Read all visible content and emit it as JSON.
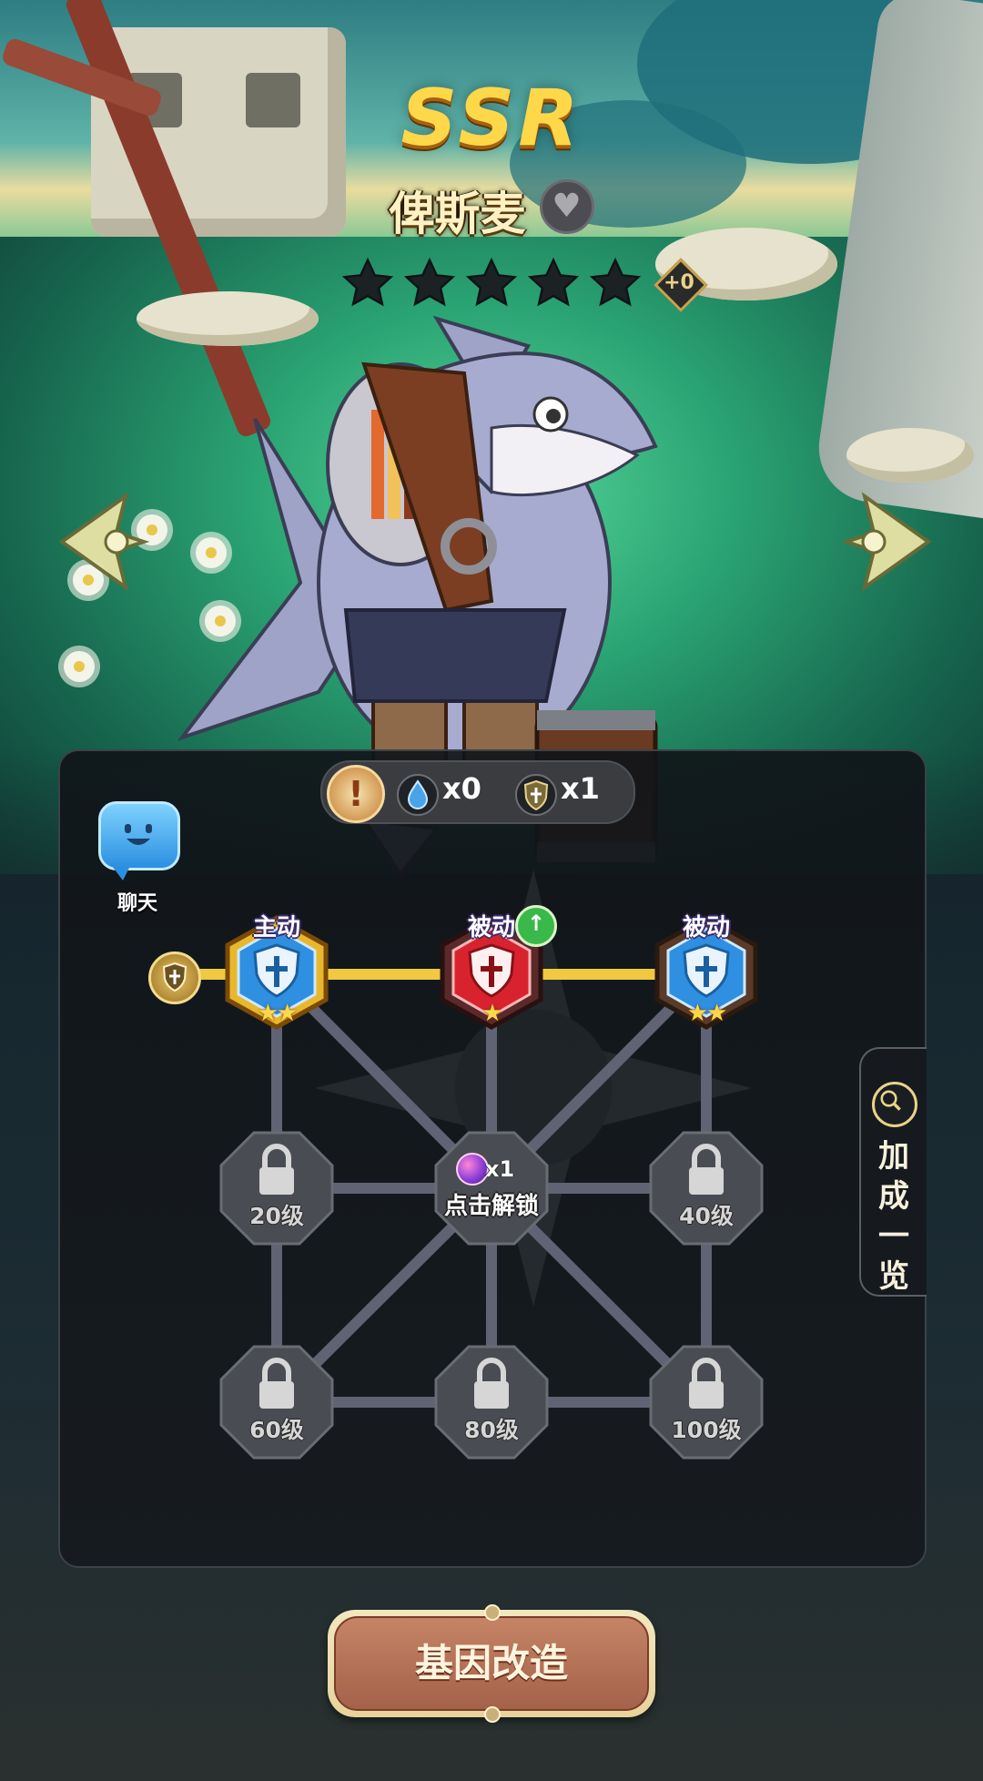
{
  "hero": {
    "rarity": "SSR",
    "name": "俾斯麦",
    "stars": 5,
    "star_bonus": "+0"
  },
  "resources": {
    "water_count": "x0",
    "shield_count": "x1"
  },
  "chat": {
    "label": "聊天"
  },
  "skills": [
    {
      "type": "主动",
      "stars": "★★",
      "color": "#2f8fe0"
    },
    {
      "type": "被动",
      "stars": "★",
      "color": "#d8232f",
      "upgrade": "↑"
    },
    {
      "type": "被动",
      "stars": "★★",
      "color": "#2f8fe0"
    }
  ],
  "gene_nodes": {
    "row1": [
      {
        "label": "20级",
        "locked": true
      },
      {
        "count": "x1",
        "label": "点击解锁",
        "locked": false
      },
      {
        "label": "40级",
        "locked": true
      }
    ],
    "row2": [
      {
        "label": "60级",
        "locked": true
      },
      {
        "label": "80级",
        "locked": true
      },
      {
        "label": "100级",
        "locked": true
      }
    ]
  },
  "bonus_tab": {
    "label": "加成一览"
  },
  "action": {
    "label": "基因改造"
  },
  "icons": {
    "favorite": "heart-icon",
    "warning": "exclamation-icon",
    "water": "water-drop-icon",
    "shield": "shield-icon",
    "chat": "chat-bubble-icon",
    "prev": "left-arrow-icon",
    "next": "right-arrow-icon",
    "lock": "lock-icon",
    "search": "magnifier-icon",
    "gem": "gene-gem-icon"
  }
}
